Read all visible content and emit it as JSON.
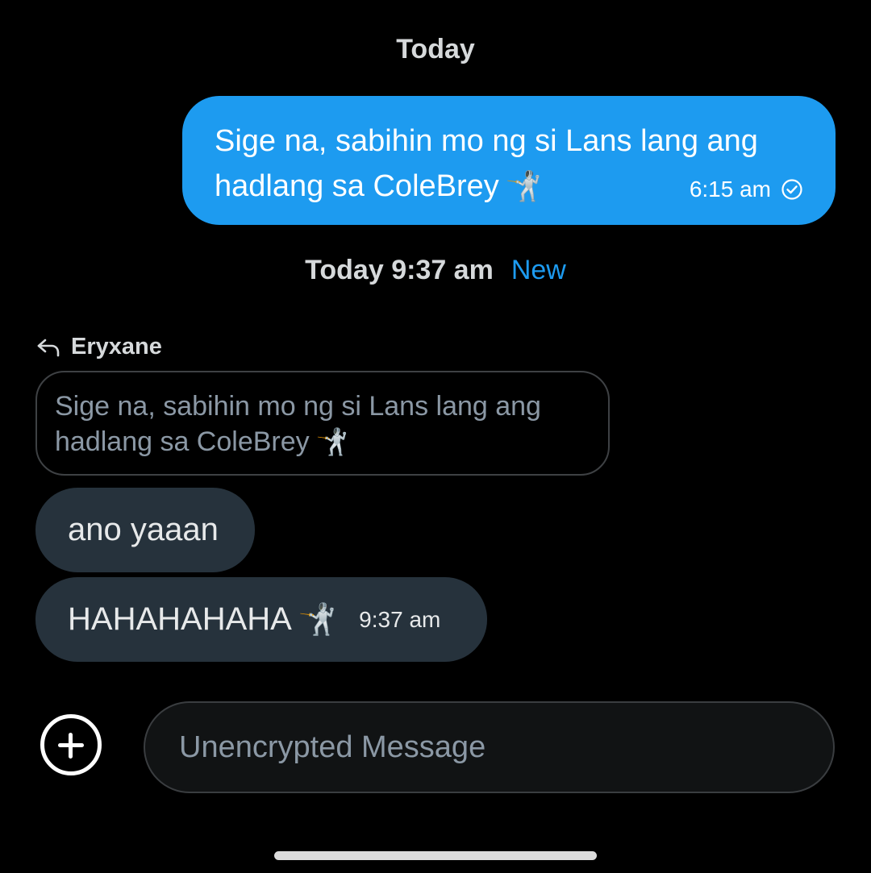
{
  "conversation": {
    "date_separator_1": "Today",
    "sent_message": {
      "text": "Sige na, sabihin mo ng si Lans lang ang hadlang sa ColeBrey",
      "emoji": "🤺",
      "time": "6:15 am",
      "status_icon": "check-circle-icon"
    },
    "date_separator_2": {
      "label": "Today 9:37 am",
      "badge": "New"
    },
    "reply": {
      "icon": "reply-arrow-icon",
      "author": "Eryxane",
      "quoted_text": "Sige na, sabihin mo ng si Lans lang ang hadlang sa ColeBrey",
      "quoted_emoji": "🤺"
    },
    "received_messages": [
      {
        "text": "ano yaaan"
      },
      {
        "text": "HAHAHAHAHA",
        "emoji": "🤺",
        "time": "9:37 am"
      }
    ]
  },
  "composer": {
    "add_icon": "plus-circle-icon",
    "placeholder": "Unencrypted Message"
  },
  "colors": {
    "background": "#000000",
    "sent_bubble": "#1d9bf0",
    "received_bubble": "#26323c",
    "accent": "#1d9bf0"
  }
}
